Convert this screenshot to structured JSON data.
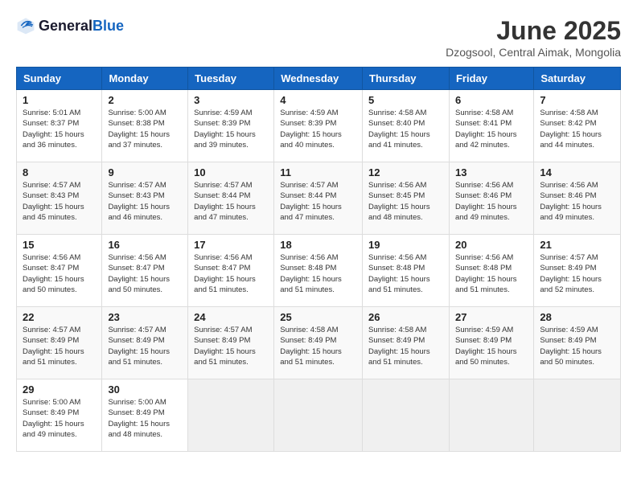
{
  "logo": {
    "general": "General",
    "blue": "Blue"
  },
  "header": {
    "month": "June 2025",
    "location": "Dzogsool, Central Aimak, Mongolia"
  },
  "weekdays": [
    "Sunday",
    "Monday",
    "Tuesday",
    "Wednesday",
    "Thursday",
    "Friday",
    "Saturday"
  ],
  "weeks": [
    [
      {
        "day": "1",
        "sunrise": "5:01 AM",
        "sunset": "8:37 PM",
        "daylight": "15 hours and 36 minutes."
      },
      {
        "day": "2",
        "sunrise": "5:00 AM",
        "sunset": "8:38 PM",
        "daylight": "15 hours and 37 minutes."
      },
      {
        "day": "3",
        "sunrise": "4:59 AM",
        "sunset": "8:39 PM",
        "daylight": "15 hours and 39 minutes."
      },
      {
        "day": "4",
        "sunrise": "4:59 AM",
        "sunset": "8:39 PM",
        "daylight": "15 hours and 40 minutes."
      },
      {
        "day": "5",
        "sunrise": "4:58 AM",
        "sunset": "8:40 PM",
        "daylight": "15 hours and 41 minutes."
      },
      {
        "day": "6",
        "sunrise": "4:58 AM",
        "sunset": "8:41 PM",
        "daylight": "15 hours and 42 minutes."
      },
      {
        "day": "7",
        "sunrise": "4:58 AM",
        "sunset": "8:42 PM",
        "daylight": "15 hours and 44 minutes."
      }
    ],
    [
      {
        "day": "8",
        "sunrise": "4:57 AM",
        "sunset": "8:43 PM",
        "daylight": "15 hours and 45 minutes."
      },
      {
        "day": "9",
        "sunrise": "4:57 AM",
        "sunset": "8:43 PM",
        "daylight": "15 hours and 46 minutes."
      },
      {
        "day": "10",
        "sunrise": "4:57 AM",
        "sunset": "8:44 PM",
        "daylight": "15 hours and 47 minutes."
      },
      {
        "day": "11",
        "sunrise": "4:57 AM",
        "sunset": "8:44 PM",
        "daylight": "15 hours and 47 minutes."
      },
      {
        "day": "12",
        "sunrise": "4:56 AM",
        "sunset": "8:45 PM",
        "daylight": "15 hours and 48 minutes."
      },
      {
        "day": "13",
        "sunrise": "4:56 AM",
        "sunset": "8:46 PM",
        "daylight": "15 hours and 49 minutes."
      },
      {
        "day": "14",
        "sunrise": "4:56 AM",
        "sunset": "8:46 PM",
        "daylight": "15 hours and 49 minutes."
      }
    ],
    [
      {
        "day": "15",
        "sunrise": "4:56 AM",
        "sunset": "8:47 PM",
        "daylight": "15 hours and 50 minutes."
      },
      {
        "day": "16",
        "sunrise": "4:56 AM",
        "sunset": "8:47 PM",
        "daylight": "15 hours and 50 minutes."
      },
      {
        "day": "17",
        "sunrise": "4:56 AM",
        "sunset": "8:47 PM",
        "daylight": "15 hours and 51 minutes."
      },
      {
        "day": "18",
        "sunrise": "4:56 AM",
        "sunset": "8:48 PM",
        "daylight": "15 hours and 51 minutes."
      },
      {
        "day": "19",
        "sunrise": "4:56 AM",
        "sunset": "8:48 PM",
        "daylight": "15 hours and 51 minutes."
      },
      {
        "day": "20",
        "sunrise": "4:56 AM",
        "sunset": "8:48 PM",
        "daylight": "15 hours and 51 minutes."
      },
      {
        "day": "21",
        "sunrise": "4:57 AM",
        "sunset": "8:49 PM",
        "daylight": "15 hours and 52 minutes."
      }
    ],
    [
      {
        "day": "22",
        "sunrise": "4:57 AM",
        "sunset": "8:49 PM",
        "daylight": "15 hours and 51 minutes."
      },
      {
        "day": "23",
        "sunrise": "4:57 AM",
        "sunset": "8:49 PM",
        "daylight": "15 hours and 51 minutes."
      },
      {
        "day": "24",
        "sunrise": "4:57 AM",
        "sunset": "8:49 PM",
        "daylight": "15 hours and 51 minutes."
      },
      {
        "day": "25",
        "sunrise": "4:58 AM",
        "sunset": "8:49 PM",
        "daylight": "15 hours and 51 minutes."
      },
      {
        "day": "26",
        "sunrise": "4:58 AM",
        "sunset": "8:49 PM",
        "daylight": "15 hours and 51 minutes."
      },
      {
        "day": "27",
        "sunrise": "4:59 AM",
        "sunset": "8:49 PM",
        "daylight": "15 hours and 50 minutes."
      },
      {
        "day": "28",
        "sunrise": "4:59 AM",
        "sunset": "8:49 PM",
        "daylight": "15 hours and 50 minutes."
      }
    ],
    [
      {
        "day": "29",
        "sunrise": "5:00 AM",
        "sunset": "8:49 PM",
        "daylight": "15 hours and 49 minutes."
      },
      {
        "day": "30",
        "sunrise": "5:00 AM",
        "sunset": "8:49 PM",
        "daylight": "15 hours and 48 minutes."
      },
      null,
      null,
      null,
      null,
      null
    ]
  ]
}
